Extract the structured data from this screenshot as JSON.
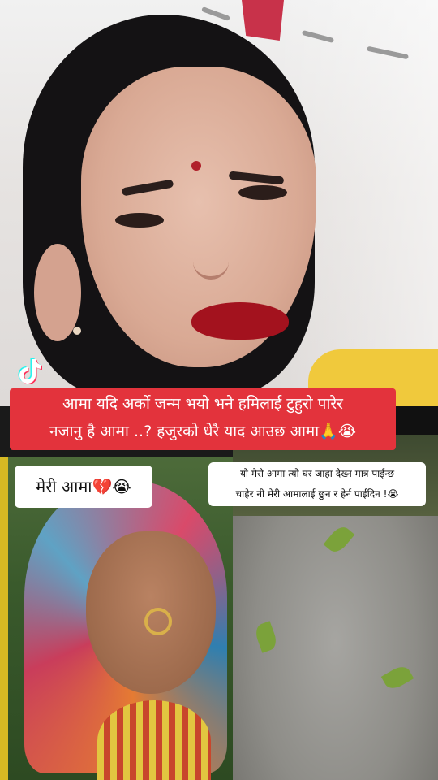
{
  "app": "TikTok",
  "icons": {
    "logo": "tiktok-logo"
  },
  "caption": {
    "line1": "आमा यदि अर्को जन्म भयो भने हमिलाई टुहुरो पारेर",
    "line2": "नजानु है आमा ..? हजुरको धेरै याद आउछ आमा🙏😭"
  },
  "left_photo": {
    "label": "मेरी आमा💔😭"
  },
  "right_photo": {
    "line1": "यो मेरो आमा त्यो घर जाहा देख्न मात्र पाईन्छ",
    "line2": "चाहेर नी मेरी आमालाई छुन र हेर्न पाईदिन !😭"
  },
  "colors": {
    "caption_bg": "#e3333c",
    "caption_text": "#ffffff",
    "label_bg": "#ffffff"
  }
}
